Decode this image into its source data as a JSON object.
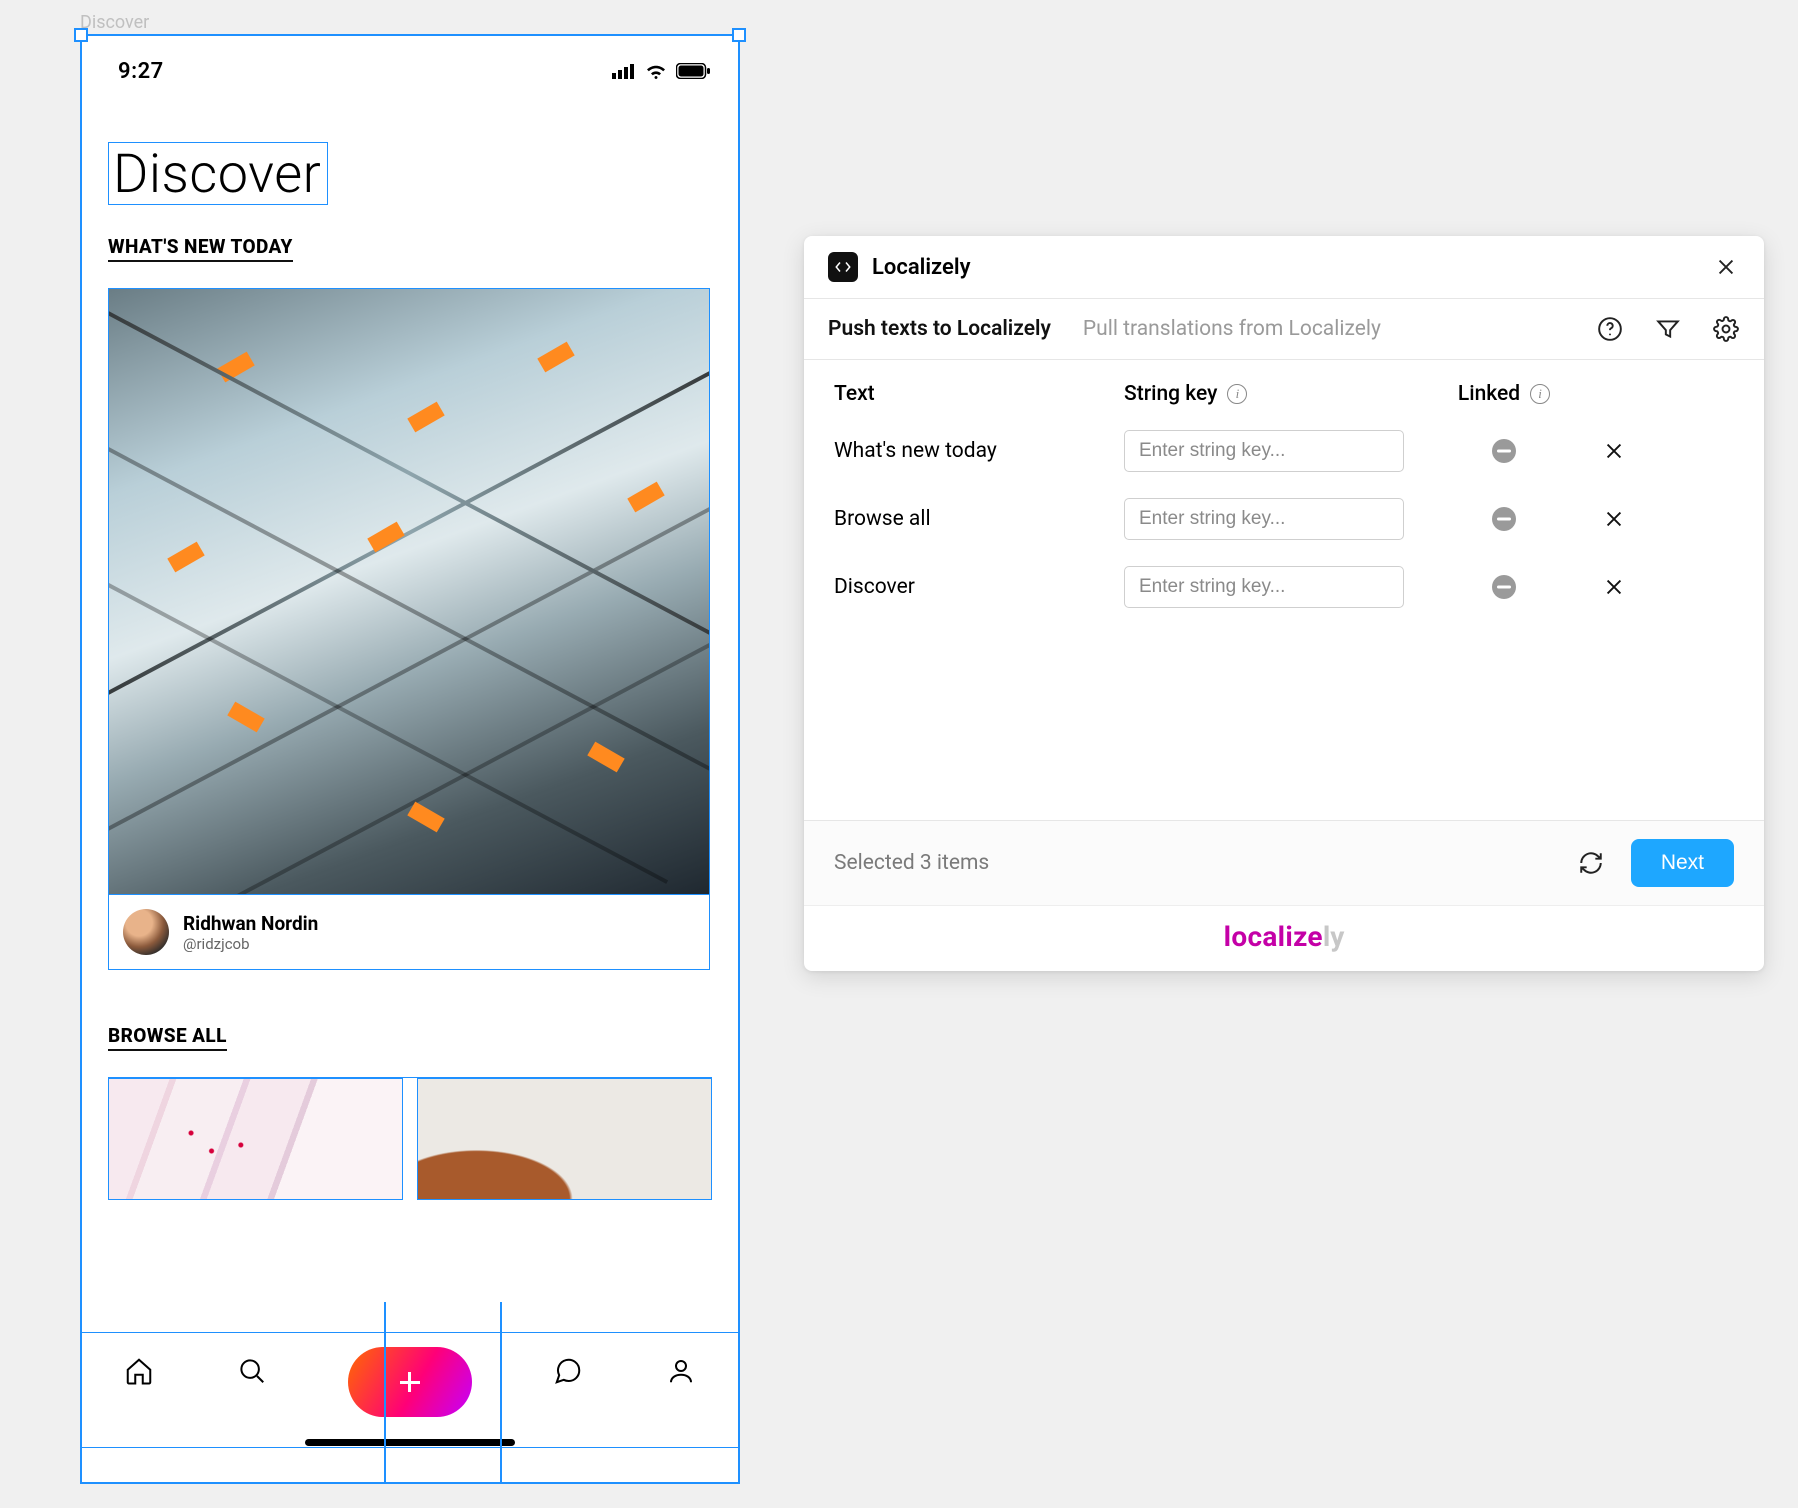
{
  "canvas": {
    "frame_label": "Discover"
  },
  "mobile": {
    "status": {
      "time": "9:27"
    },
    "title": "Discover",
    "section_new": "WHAT'S NEW TODAY",
    "section_browse": "BROWSE ALL",
    "user": {
      "name": "Ridhwan Nordin",
      "handle": "@ridzjcob"
    }
  },
  "panel": {
    "title": "Localizely",
    "tabs": {
      "push": "Push texts to Localizely",
      "pull": "Pull translations from Localizely"
    },
    "columns": {
      "text": "Text",
      "key": "String key",
      "linked": "Linked"
    },
    "key_placeholder": "Enter string key...",
    "rows": [
      {
        "text": "What's new today"
      },
      {
        "text": "Browse all"
      },
      {
        "text": "Discover"
      }
    ],
    "footer": {
      "selected": "Selected 3 items",
      "next": "Next"
    },
    "brand": {
      "a": "localize",
      "b": "ly"
    }
  }
}
